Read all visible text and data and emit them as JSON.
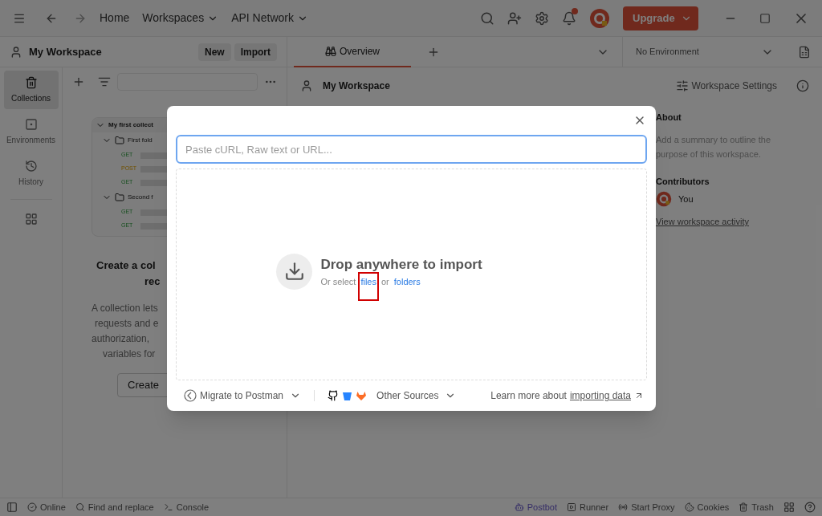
{
  "title_bar": {
    "nav": [
      {
        "label": "Home",
        "dropdown": false
      },
      {
        "label": "Workspaces",
        "dropdown": true
      },
      {
        "label": "API Network",
        "dropdown": true
      }
    ],
    "notification": true,
    "upgrade": "Upgrade"
  },
  "sidebar": {
    "workspace": "My Workspace",
    "buttons": [
      "New",
      "Import"
    ],
    "rail": [
      {
        "label": "Collections",
        "selected": true
      },
      {
        "label": "Environments",
        "selected": false
      },
      {
        "label": "History",
        "selected": false
      }
    ],
    "preview": {
      "collection": "My first collect",
      "folders": [
        {
          "name": "First fold",
          "requests": [
            {
              "method": "GET",
              "kind": "get"
            },
            {
              "method": "POST",
              "kind": "post"
            },
            {
              "method": "GET",
              "kind": "get"
            }
          ]
        },
        {
          "name": "Second f",
          "requests": [
            {
              "method": "GET",
              "kind": "get"
            },
            {
              "method": "GET",
              "kind": "get"
            }
          ]
        }
      ]
    },
    "empty_title": [
      "Create a col",
      "rec"
    ],
    "empty_text": [
      "A collection lets",
      "requests and e",
      "authorization,",
      "variables for"
    ],
    "create_button": "Create"
  },
  "tabs": [
    {
      "label": "Overview",
      "selected": true
    }
  ],
  "environment": "No Environment",
  "workspace_header": {
    "title": "My Workspace",
    "settings": "Workspace Settings"
  },
  "about": {
    "title": "About",
    "summary": "Add a summary to outline the purpose of this workspace.",
    "contributors_title": "Contributors",
    "contributors": [
      "You"
    ],
    "activity_link": "View workspace activity"
  },
  "import_dialog": {
    "placeholder": "Paste cURL, Raw text or URL...",
    "drop_title": "Drop anywhere to import",
    "drop_prefix": "Or select",
    "files_link": "files",
    "or": "or",
    "folders_link": "folders",
    "migrate": "Migrate to Postman",
    "other_sources": "Other Sources",
    "learn_prefix": "Learn more about",
    "learn_link": "importing data"
  },
  "status_bar": {
    "left": [
      "Online",
      "Find and replace",
      "Console"
    ],
    "right": [
      "Postbot",
      "Runner",
      "Start Proxy",
      "Cookies",
      "Trash"
    ]
  }
}
